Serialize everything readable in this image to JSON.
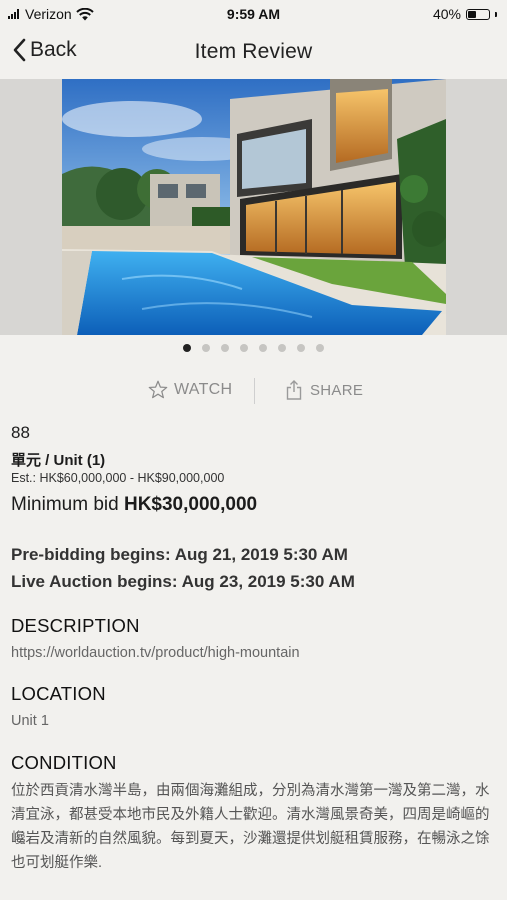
{
  "status": {
    "carrier": "Verizon",
    "time": "9:59 AM",
    "battery": "40%",
    "battery_level": 0.4
  },
  "nav": {
    "back_label": "Back",
    "title": "Item Review"
  },
  "gallery": {
    "image_count": 8,
    "active_index": 0
  },
  "actions": {
    "watch_label": "WATCH",
    "share_label": "SHARE"
  },
  "item": {
    "lot_number": "88",
    "unit_title": "單元 / Unit (1)",
    "estimate": "Est.: HK$60,000,000 - HK$90,000,000",
    "min_bid_label": "Minimum bid",
    "min_bid_value": "HK$30,000,000",
    "pre_bidding": "Pre-bidding begins: Aug 21, 2019 5:30 AM",
    "live_auction": "Live Auction begins: Aug 23, 2019 5:30 AM"
  },
  "description": {
    "heading": "DESCRIPTION",
    "text": "https://worldauction.tv/product/high-mountain"
  },
  "location": {
    "heading": "LOCATION",
    "text": "Unit 1"
  },
  "condition": {
    "heading": "CONDITION",
    "text": "位於西貢清水灣半島，由兩個海灘組成，分別為清水灣第一灣及第二灣，水清宜泳，都甚受本地市民及外籍人士歡迎。清水灣風景奇美，四周是崎嶇的巉岩及清新的自然風貌。每到夏天，沙灘還提供划艇租賃服務，在暢泳之馀也可划艇作樂."
  }
}
